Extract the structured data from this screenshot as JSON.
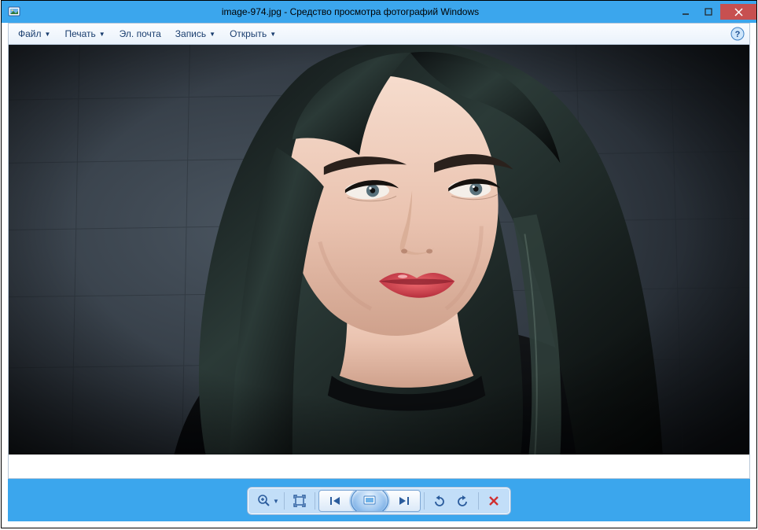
{
  "window": {
    "title": "image-974.jpg - Средство просмотра фотографий Windows"
  },
  "menu": {
    "file": "Файл",
    "print": "Печать",
    "email": "Эл. почта",
    "burn": "Запись",
    "open": "Открыть"
  },
  "icons": {
    "app": "photo-app-icon",
    "min": "minimize-icon",
    "max": "maximize-icon",
    "close": "close-icon",
    "help": "help-icon",
    "zoom": "magnifier-icon",
    "fit": "fit-window-icon",
    "prev": "previous-icon",
    "slideshow": "slideshow-icon",
    "next": "next-icon",
    "rotl": "rotate-ccw-icon",
    "rotr": "rotate-cw-icon",
    "del": "delete-icon",
    "chev": "chevron-down-icon"
  }
}
